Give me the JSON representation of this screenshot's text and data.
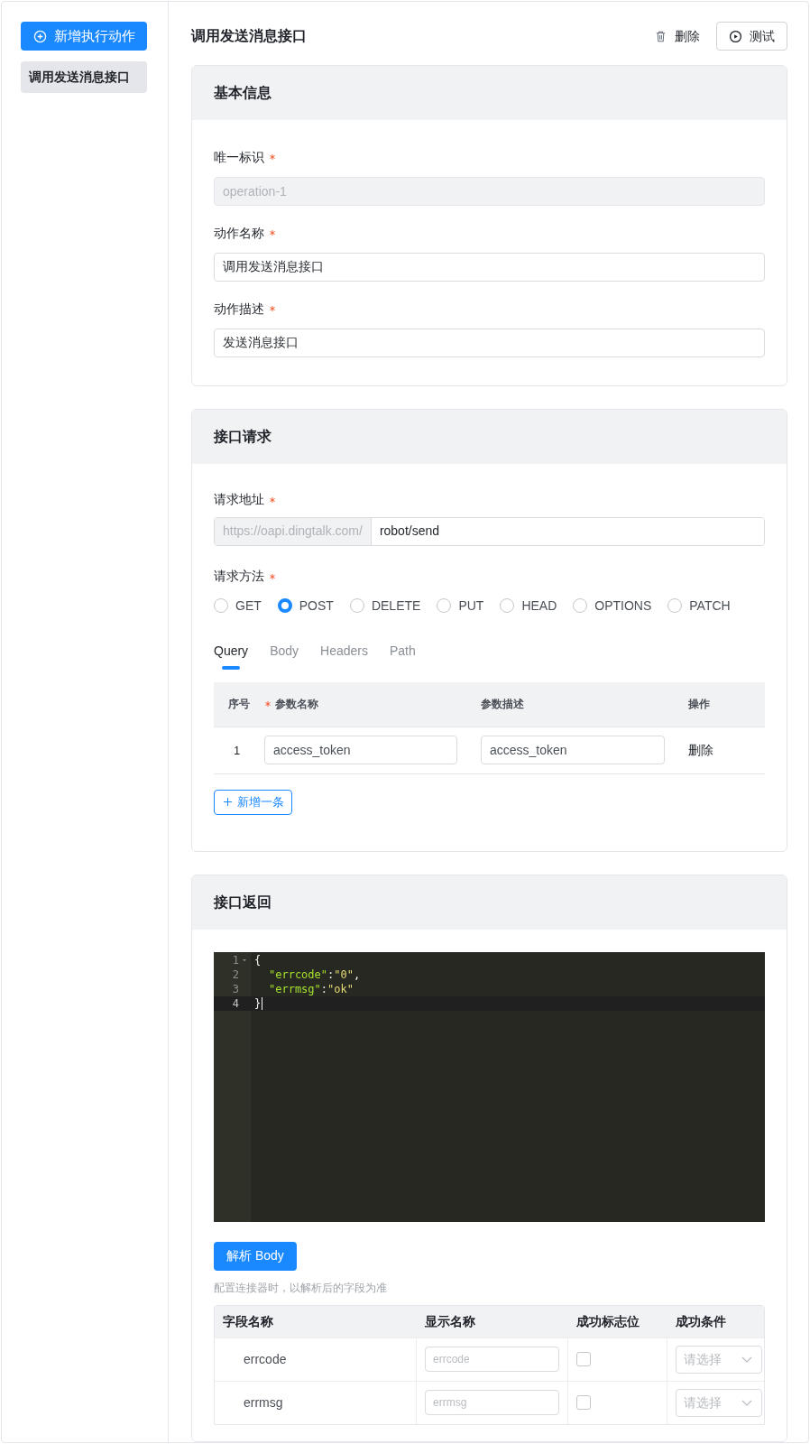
{
  "sidebar": {
    "add_button": "新增执行动作",
    "items": [
      {
        "label": "调用发送消息接口",
        "selected": true
      }
    ]
  },
  "header": {
    "title": "调用发送消息接口",
    "delete_button": "删除",
    "test_button": "测试"
  },
  "basic_info": {
    "title": "基本信息",
    "fields": [
      {
        "label": "唯一标识",
        "required": true,
        "value": "operation-1",
        "disabled": true
      },
      {
        "label": "动作名称",
        "required": true,
        "value": "调用发送消息接口",
        "disabled": false
      },
      {
        "label": "动作描述",
        "required": true,
        "value": "发送消息接口",
        "disabled": false
      }
    ]
  },
  "request": {
    "title": "接口请求",
    "url": {
      "label": "请求地址",
      "required": true,
      "prefix": "https://oapi.dingtalk.com/",
      "value": "robot/send"
    },
    "method": {
      "label": "请求方法",
      "required": true,
      "options": [
        {
          "label": "GET",
          "selected": false
        },
        {
          "label": "POST",
          "selected": true
        },
        {
          "label": "DELETE",
          "selected": false
        },
        {
          "label": "PUT",
          "selected": false
        },
        {
          "label": "HEAD",
          "selected": false
        },
        {
          "label": "OPTIONS",
          "selected": false
        },
        {
          "label": "PATCH",
          "selected": false
        }
      ]
    },
    "tabs": [
      {
        "label": "Query",
        "selected": true
      },
      {
        "label": "Body",
        "selected": false
      },
      {
        "label": "Headers",
        "selected": false
      },
      {
        "label": "Path",
        "selected": false
      }
    ],
    "params_table": {
      "columns": [
        {
          "label": "序号",
          "required": false
        },
        {
          "label": "参数名称",
          "required": true
        },
        {
          "label": "参数描述",
          "required": false
        },
        {
          "label": "操作",
          "required": false
        }
      ],
      "rows": [
        {
          "index": "1",
          "name": "access_token",
          "description": "access_token",
          "action": "删除"
        }
      ]
    },
    "add_button": "新增一条"
  },
  "response": {
    "title": "接口返回",
    "editor": {
      "lines": [
        {
          "number": "1",
          "foldable": true,
          "active": false,
          "indent": false,
          "tokens": [
            {
              "kind": "punct",
              "text": "{"
            }
          ]
        },
        {
          "number": "2",
          "foldable": false,
          "active": false,
          "indent": true,
          "tokens": [
            {
              "kind": "key",
              "text": "\"errcode\""
            },
            {
              "kind": "punct",
              "text": ":"
            },
            {
              "kind": "string",
              "text": "\"0\""
            },
            {
              "kind": "punct",
              "text": ","
            }
          ]
        },
        {
          "number": "3",
          "foldable": false,
          "active": false,
          "indent": true,
          "tokens": [
            {
              "kind": "key",
              "text": "\"errmsg\""
            },
            {
              "kind": "punct",
              "text": ":"
            },
            {
              "kind": "string",
              "text": "\"ok\""
            }
          ]
        },
        {
          "number": "4",
          "foldable": false,
          "active": true,
          "indent": false,
          "tokens": [
            {
              "kind": "punct",
              "text": "}"
            }
          ]
        }
      ]
    },
    "parse_button": "解析 Body",
    "hint": "配置连接器时，以解析后的字段为准",
    "fields_table": {
      "columns": [
        "字段名称",
        "显示名称",
        "成功标志位",
        "成功条件"
      ],
      "rows": [
        {
          "field": "errcode",
          "display_placeholder": "errcode",
          "success_flag": false,
          "condition_placeholder": "请选择"
        },
        {
          "field": "errmsg",
          "display_placeholder": "errmsg",
          "success_flag": false,
          "condition_placeholder": "请选择"
        }
      ]
    }
  }
}
